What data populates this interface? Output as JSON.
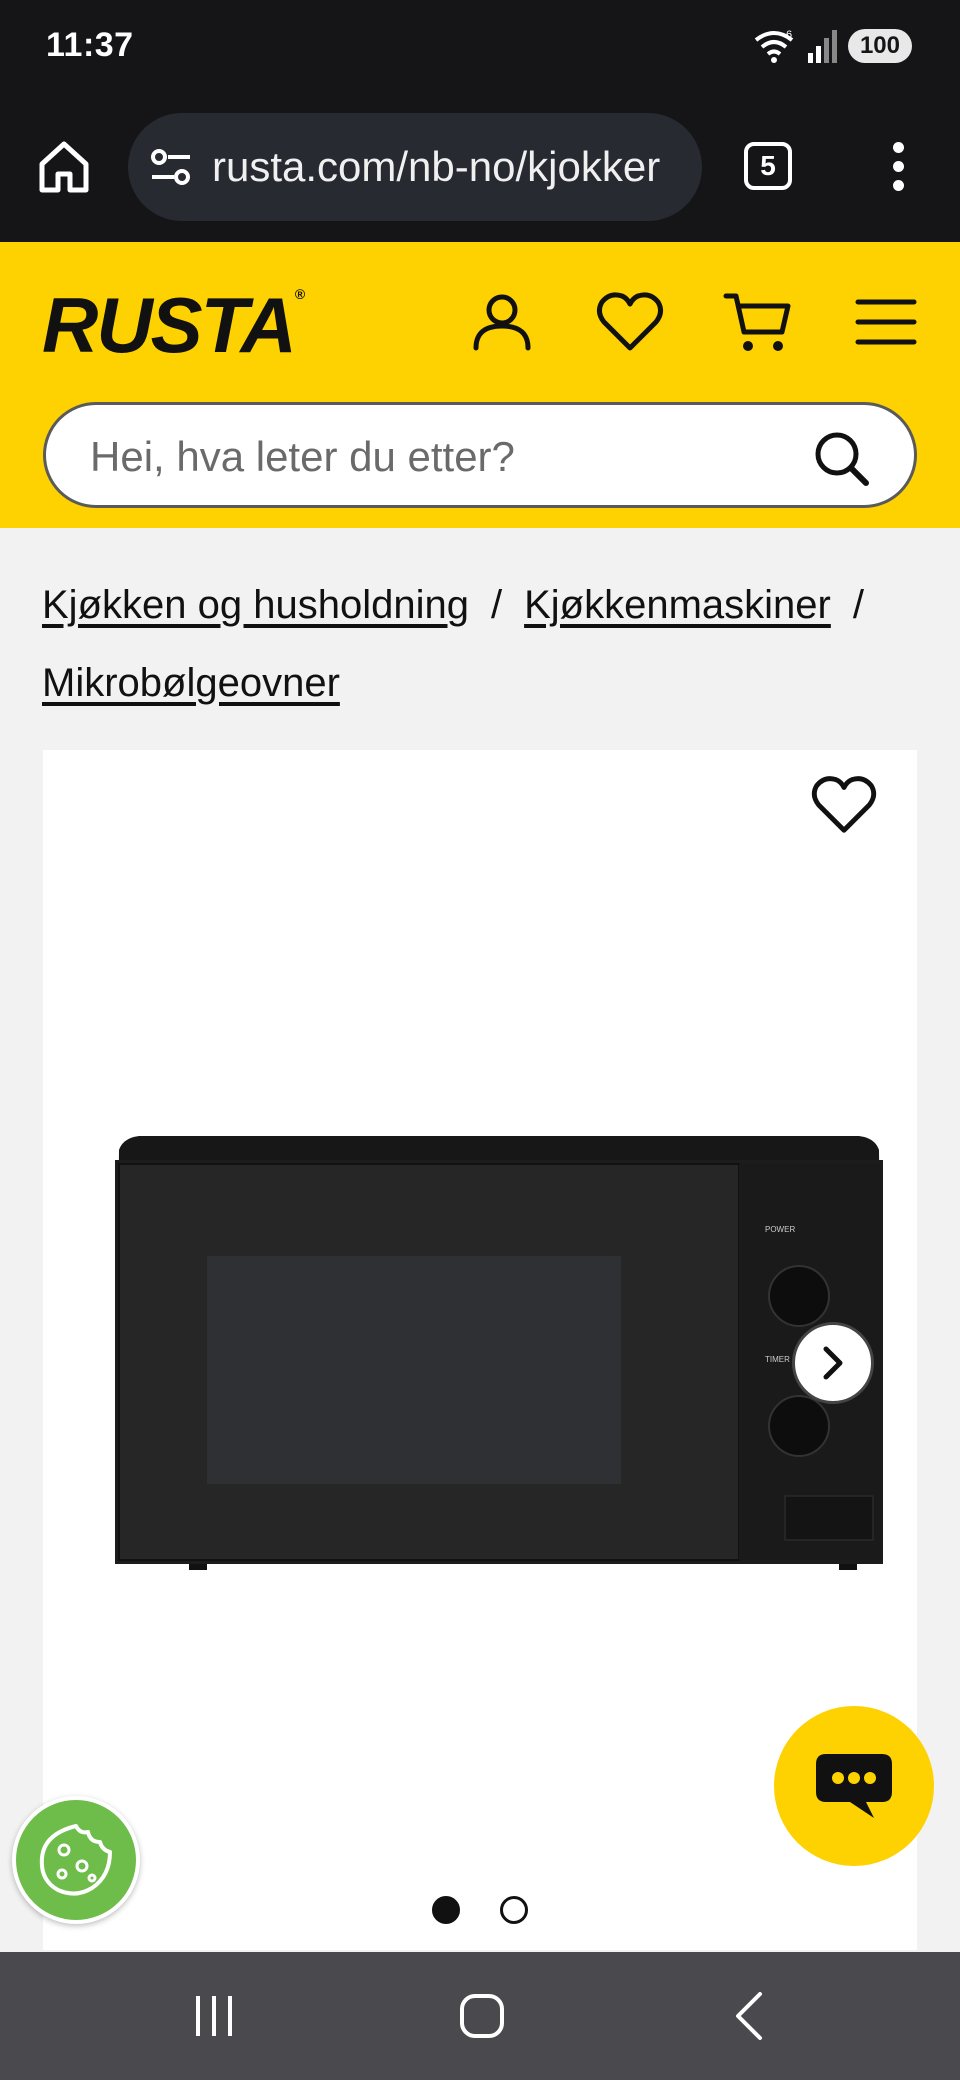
{
  "status_bar": {
    "time": "11:37",
    "wifi_label": "6",
    "battery": "100"
  },
  "browser": {
    "url": "rusta.com/nb-no/kjokker",
    "tab_count": "5"
  },
  "site": {
    "logo": "RUSTA",
    "logo_mark": "®",
    "search_placeholder": "Hei, hva leter du etter?",
    "brand_color": "#fed100"
  },
  "breadcrumb": {
    "items": [
      "Kjøkken og husholdning",
      "Kjøkkenmaskiner",
      "Mikrobølgeovner"
    ],
    "separator": "/"
  },
  "product": {
    "image_labels": {
      "power": "POWER",
      "timer": "TIMER"
    },
    "carousel": {
      "total": 2,
      "active": 1
    }
  }
}
